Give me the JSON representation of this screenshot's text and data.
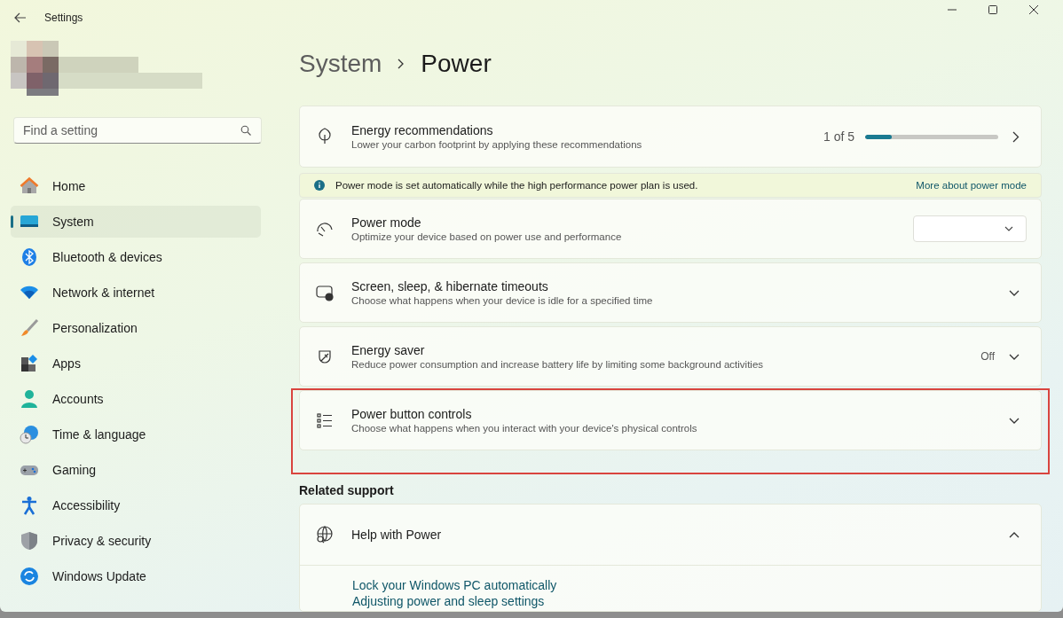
{
  "window": {
    "title": "Settings"
  },
  "search": {
    "placeholder": "Find a setting"
  },
  "sidebar": {
    "items": [
      {
        "label": "Home",
        "selected": false
      },
      {
        "label": "System",
        "selected": true
      },
      {
        "label": "Bluetooth & devices",
        "selected": false
      },
      {
        "label": "Network & internet",
        "selected": false
      },
      {
        "label": "Personalization",
        "selected": false
      },
      {
        "label": "Apps",
        "selected": false
      },
      {
        "label": "Accounts",
        "selected": false
      },
      {
        "label": "Time & language",
        "selected": false
      },
      {
        "label": "Gaming",
        "selected": false
      },
      {
        "label": "Accessibility",
        "selected": false
      },
      {
        "label": "Privacy & security",
        "selected": false
      },
      {
        "label": "Windows Update",
        "selected": false
      }
    ]
  },
  "breadcrumb": [
    "System",
    "Power"
  ],
  "cards": [
    {
      "kind": "recommendations",
      "title": "Energy recommendations",
      "subtitle": "Lower your carbon footprint by applying these recommendations",
      "progress": "1 of 5",
      "level": 0.2
    },
    {
      "kind": "notice",
      "text": "Power mode is set automatically while the high performance power plan is used.",
      "link": "More about power mode"
    },
    {
      "kind": "dropdown",
      "title": "Power mode",
      "subtitle": "Optimize your device based on power use and performance"
    },
    {
      "kind": "expander",
      "title": "Screen, sleep, & hibernate timeouts",
      "subtitle": "Choose what happens when your device is idle for a specified time",
      "expanded": false,
      "highlighted": false
    },
    {
      "kind": "expander",
      "title": "Energy saver",
      "subtitle": "Reduce power consumption and increase battery life by limiting some background activities",
      "value": "Off",
      "expanded": false,
      "highlighted": false
    },
    {
      "kind": "expander",
      "title": "Power button controls",
      "subtitle": "Choose what happens when you interact with your device's physical controls",
      "expanded": false,
      "highlighted": true
    }
  ],
  "related": {
    "heading": "Related support",
    "help": {
      "title": "Help with Power",
      "expanded": true,
      "links": [
        "Lock your Windows PC automatically",
        "Adjusting power and sleep settings"
      ]
    }
  }
}
